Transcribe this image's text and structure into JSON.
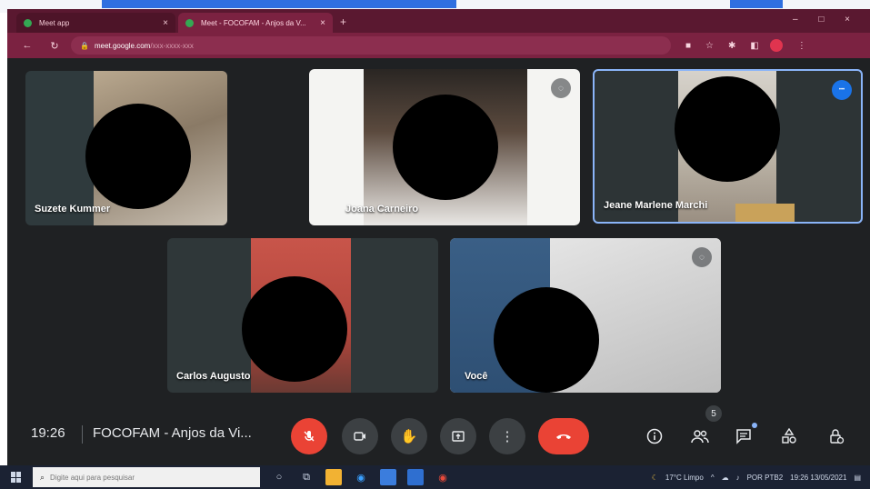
{
  "browser": {
    "tabs": [
      {
        "label": "Meet app",
        "favicon_color": "#34a853"
      },
      {
        "label": "Meet - FOCOFAM - Anjos da V...",
        "favicon_color": "#34a853"
      }
    ],
    "url_host": "meet.google.com",
    "url_path": "/xxx-xxxx-xxx",
    "new_tab": "+",
    "window_controls": "– □ ×"
  },
  "participants": [
    {
      "name": "Suzete Kummer",
      "badge": ""
    },
    {
      "name": "Joana Carneiro",
      "badge": ""
    },
    {
      "name": "Jeane Marlene Marchi",
      "badge": ""
    },
    {
      "name": "Carlos Augusto",
      "badge": ""
    },
    {
      "name": "Você",
      "badge": ""
    }
  ],
  "meeting": {
    "time": "19:26",
    "title": "FOCOFAM - Anjos da Vi...",
    "people_count": "5"
  },
  "icons": {
    "mic": "mic-off-icon",
    "camera": "camera-icon",
    "hand": "raise-hand-icon",
    "present": "present-screen-icon",
    "more": "more-options-icon",
    "leave": "leave-call-icon",
    "info": "info-icon",
    "people": "people-icon",
    "chat": "chat-icon",
    "activities": "activities-icon",
    "host": "host-controls-icon"
  },
  "taskbar": {
    "search_placeholder": "Digite aqui para pesquisar",
    "weather": "17°C Limpo",
    "lang": "POR PTB2",
    "clock": "19:26 13/05/2021"
  },
  "colors": {
    "browser_frame": "#5a1830",
    "meet_background": "#1f2123",
    "leave_red": "#ea4335",
    "active_speaker_border": "#8ab4f8",
    "taskbar": "#1b2233"
  }
}
